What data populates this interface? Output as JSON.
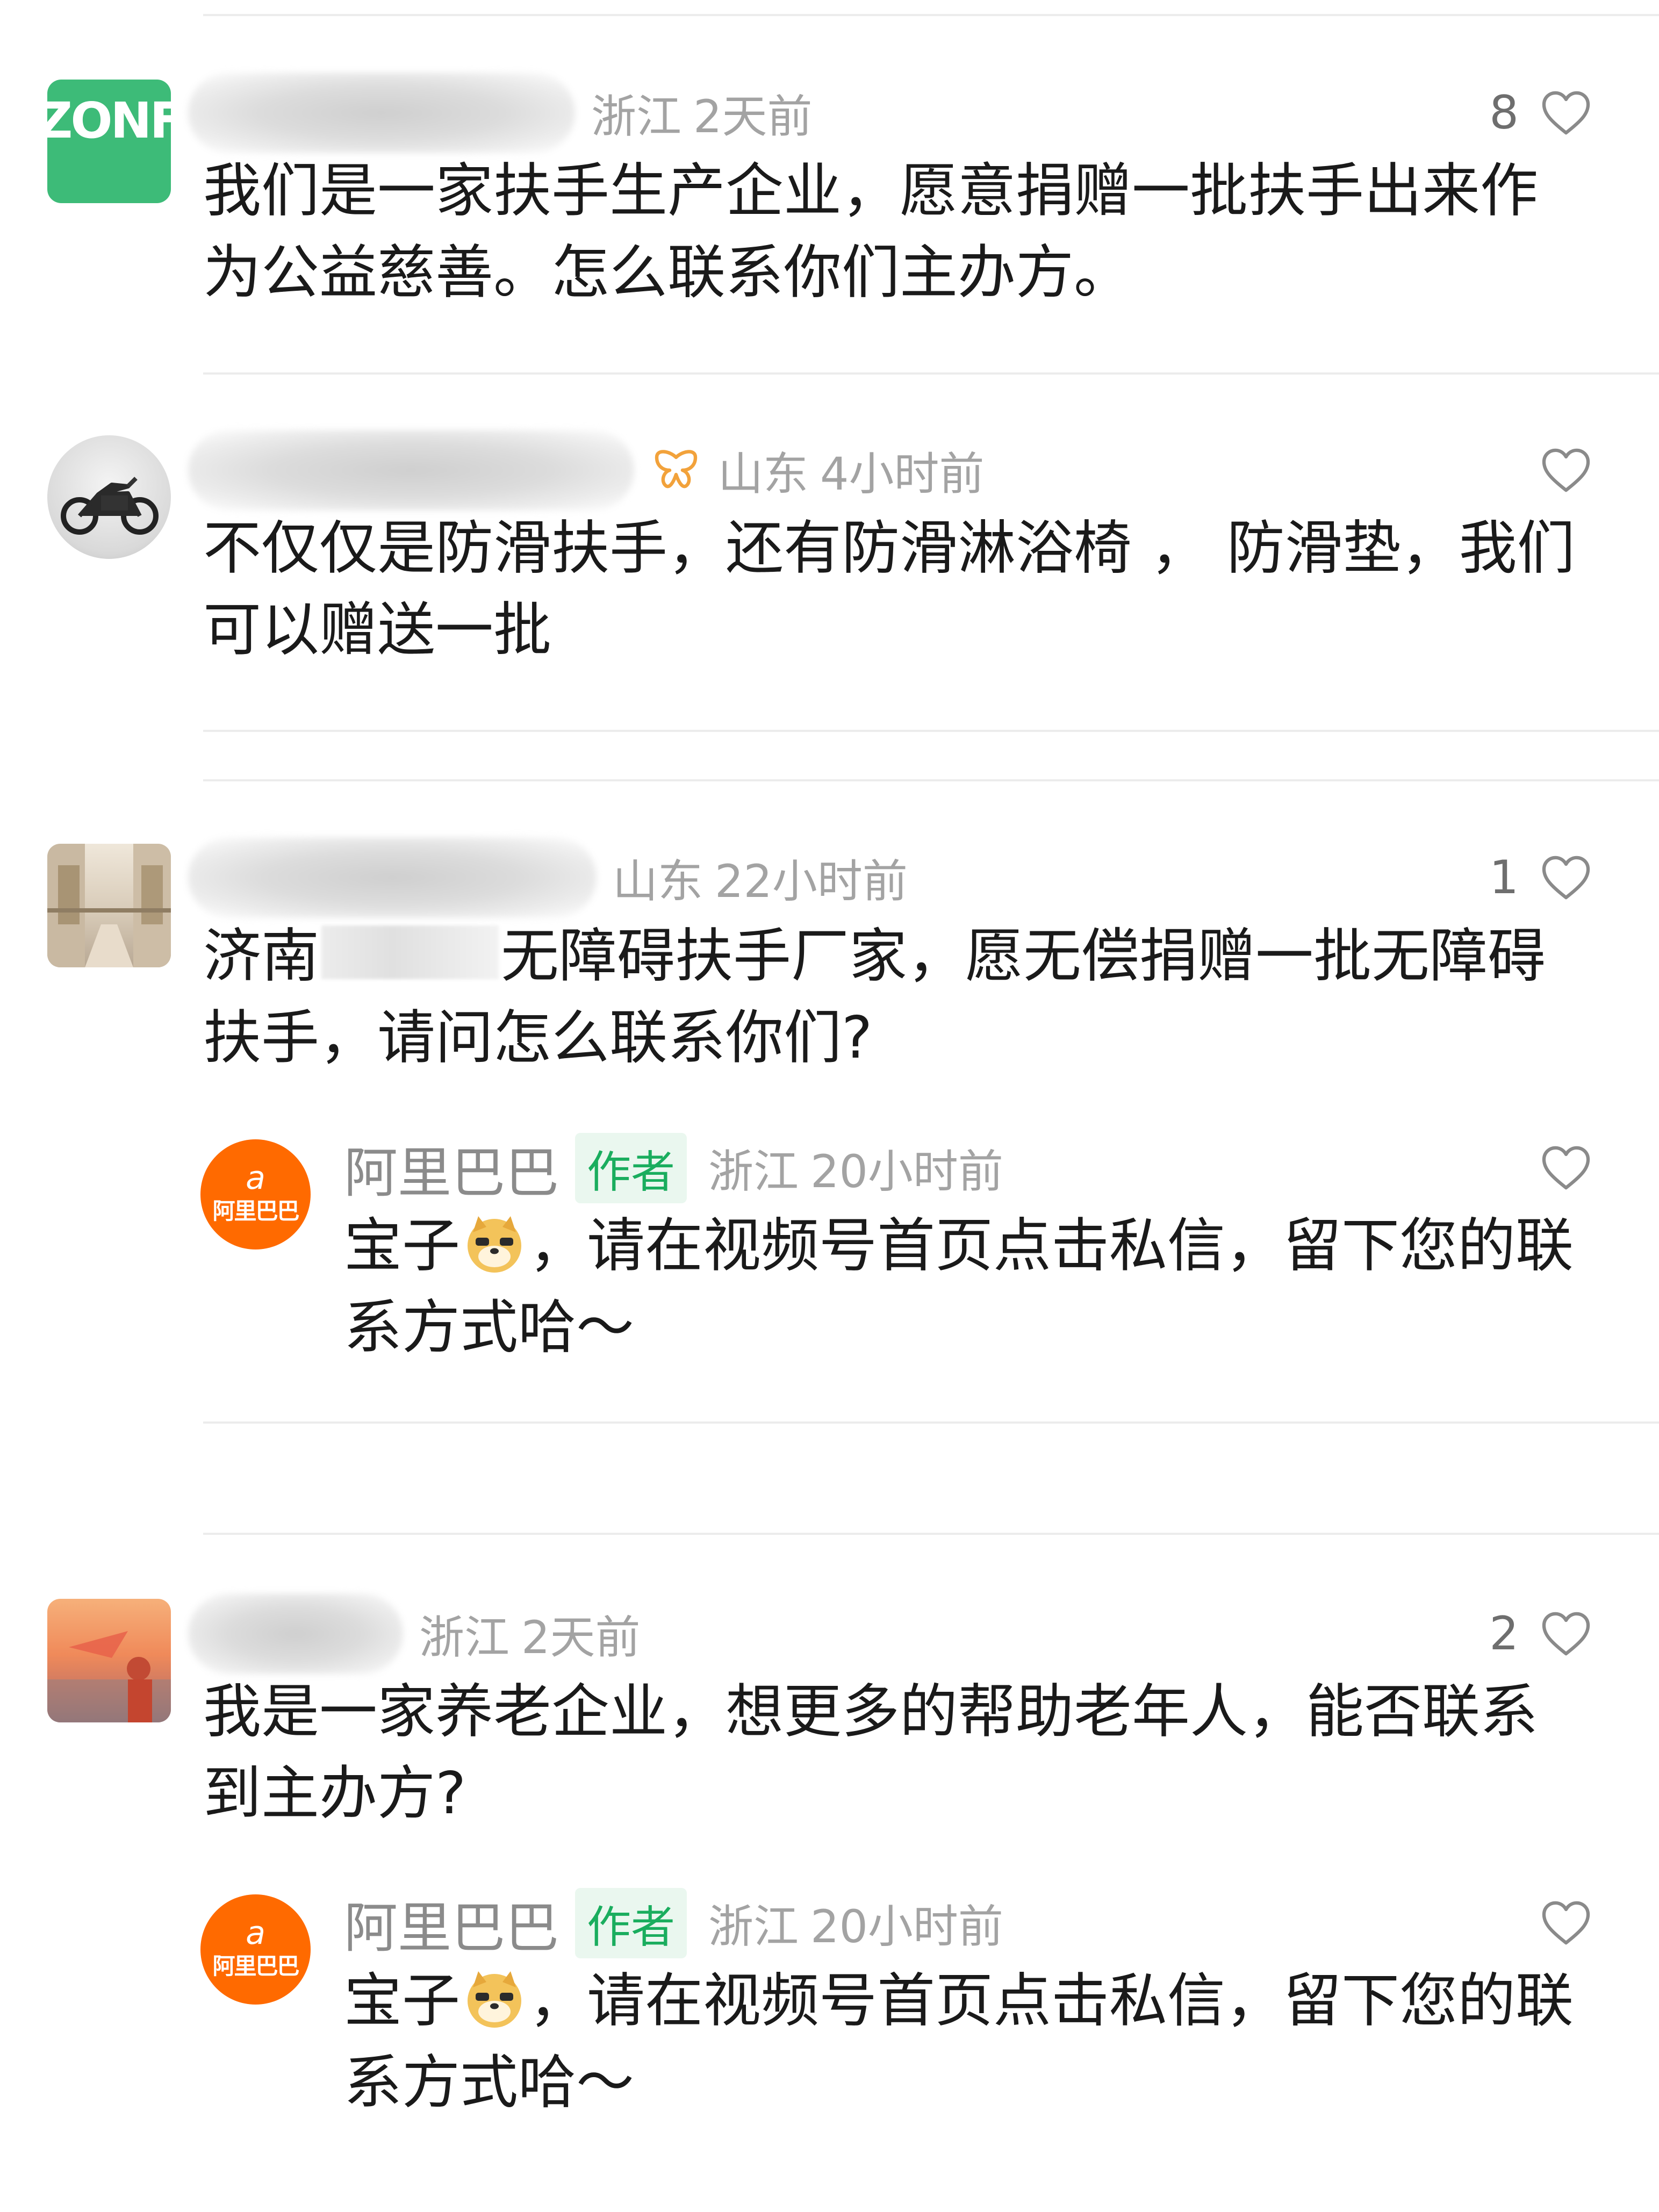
{
  "colors": {
    "author_tag": "#1aad5e",
    "author_tag_bg": "#eaf7ef",
    "alibaba_orange": "#ff6a00",
    "meta_gray": "#a3a3a3",
    "text": "#1a1a1a"
  },
  "comments": [
    {
      "avatar": "zonf-logo-avatar",
      "avatar_logo_text": "ZONF",
      "location": "浙江",
      "time": "2天前",
      "likes": "8",
      "text": "我们是一家扶手生产企业，愿意捐赠一批扶手出来作为公益慈善。怎么联系你们主办方。"
    },
    {
      "avatar": "motorcycle-avatar",
      "location": "山东",
      "time": "4小时前",
      "likes": "",
      "text": "不仅仅是防滑扶手，还有防滑淋浴椅 ， 防滑垫，我们可以赠送一批"
    },
    {
      "avatar": "hallway-avatar",
      "location": "山东",
      "time": "22小时前",
      "likes": "1",
      "text_before": "济南",
      "text_after": "无障碍扶手厂家，愿无偿捐赠一批无障碍扶手，请问怎么联系你们?",
      "reply": {
        "author": "阿里巴巴",
        "tag": "作者",
        "location": "浙江",
        "time": "20小时前",
        "text_before": "宝子",
        "text_after": "，请在视频号首页点击私信，留下您的联系方式哈～",
        "emoji": "doge-emoji",
        "logo_text": "阿里巴巴"
      }
    },
    {
      "avatar": "sunset-avatar",
      "location": "浙江",
      "time": "2天前",
      "likes": "2",
      "text": "我是一家养老企业，想更多的帮助老年人，能否联系到主办方?",
      "reply": {
        "author": "阿里巴巴",
        "tag": "作者",
        "location": "浙江",
        "time": "20小时前",
        "text_before": "宝子",
        "text_after": "，请在视频号首页点击私信，留下您的联系方式哈～",
        "emoji": "doge-emoji",
        "logo_text": "阿里巴巴"
      }
    }
  ]
}
